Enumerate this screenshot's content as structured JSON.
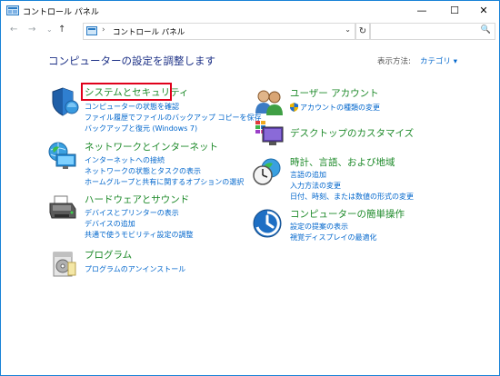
{
  "window": {
    "title": "コントロール パネル",
    "minimize": "—",
    "maximize": "☐",
    "close": "✕"
  },
  "address": {
    "back": "←",
    "forward": "→",
    "recent": "⌄",
    "up": "↑",
    "separator": "›",
    "breadcrumb": "コントロール パネル",
    "dropdown": "⌄",
    "refresh": "↻",
    "search_placeholder": "",
    "search_icon": "🔍"
  },
  "header": {
    "heading": "コンピューターの設定を調整します",
    "view_by_label": "表示方法:",
    "view_by_value": "カテゴリ ▾"
  },
  "categories": {
    "system": {
      "title": "システムとセキュリティ",
      "links": [
        "コンピューターの状態を確認",
        "ファイル履歴でファイルのバックアップ コピーを保存",
        "バックアップと復元 (Windows 7)"
      ]
    },
    "network": {
      "title": "ネットワークとインターネット",
      "links": [
        "インターネットへの接続",
        "ネットワークの状態とタスクの表示",
        "ホームグループと共有に関するオプションの選択"
      ]
    },
    "hardware": {
      "title": "ハードウェアとサウンド",
      "links": [
        "デバイスとプリンターの表示",
        "デバイスの追加",
        "共通で使うモビリティ設定の調整"
      ]
    },
    "programs": {
      "title": "プログラム",
      "links": [
        "プログラムのアンインストール"
      ]
    },
    "users": {
      "title": "ユーザー アカウント",
      "links": [
        "アカウントの種類の変更"
      ]
    },
    "desktop": {
      "title": "デスクトップのカスタマイズ",
      "links": []
    },
    "clock": {
      "title": "時計、言語、および地域",
      "links": [
        "言語の追加",
        "入力方法の変更",
        "日付、時刻、または数値の形式の変更"
      ]
    },
    "ease": {
      "title": "コンピューターの簡単操作",
      "links": [
        "設定の提案の表示",
        "視覚ディスプレイの最適化"
      ]
    }
  },
  "colors": {
    "link": "#0066cc",
    "category_title": "#1e8a2a",
    "heading": "#1e3287",
    "highlight_border": "#e0001b"
  }
}
